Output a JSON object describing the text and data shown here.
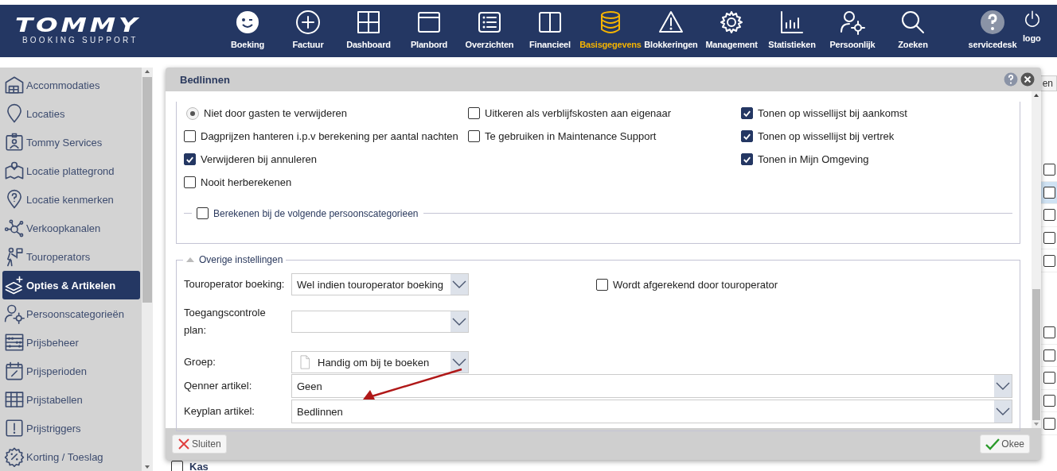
{
  "header": {
    "logo": {
      "title": "TOMMY",
      "subtitle": "BOOKING SUPPORT"
    },
    "nav": [
      {
        "label": "Boeking",
        "selected": false
      },
      {
        "label": "Factuur",
        "selected": false
      },
      {
        "label": "Dashboard",
        "selected": false
      },
      {
        "label": "Planbord",
        "selected": false
      },
      {
        "label": "Overzichten",
        "selected": false
      },
      {
        "label": "Financieel",
        "selected": false
      },
      {
        "label": "Basisgegevens",
        "selected": true
      },
      {
        "label": "Blokkeringen",
        "selected": false
      },
      {
        "label": "Management",
        "selected": false
      },
      {
        "label": "Statistieken",
        "selected": false
      },
      {
        "label": "Persoonlijk",
        "selected": false
      },
      {
        "label": "Zoeken",
        "selected": false
      }
    ],
    "right": [
      {
        "label": "servicedesk"
      },
      {
        "label": "logo"
      }
    ]
  },
  "sidebar": {
    "items": [
      {
        "label": "Accommodaties",
        "selected": false
      },
      {
        "label": "Locaties",
        "selected": false
      },
      {
        "label": "Tommy Services",
        "selected": false
      },
      {
        "label": "Locatie plattegrond",
        "selected": false
      },
      {
        "label": "Locatie kenmerken",
        "selected": false
      },
      {
        "label": "Verkoopkanalen",
        "selected": false
      },
      {
        "label": "Touroperators",
        "selected": false
      },
      {
        "label": "Opties & Artikelen",
        "selected": true
      },
      {
        "label": "Persoonscategorieën",
        "selected": false
      },
      {
        "label": "Prijsbeheer",
        "selected": false
      },
      {
        "label": "Prijsperioden",
        "selected": false
      },
      {
        "label": "Prijstabellen",
        "selected": false
      },
      {
        "label": "Prijstriggers",
        "selected": false
      },
      {
        "label": "Korting / Toeslag",
        "selected": false
      }
    ]
  },
  "background": {
    "button": "en",
    "rows": [
      {
        "checked": false,
        "selected": false
      },
      {
        "checked": false,
        "selected": true
      },
      {
        "checked": false,
        "selected": false
      },
      {
        "checked": false,
        "selected": false
      },
      {
        "checked": false,
        "selected": false
      },
      {
        "checked": false,
        "selected": false
      },
      {
        "checked": false,
        "selected": false
      },
      {
        "checked": false,
        "selected": false
      },
      {
        "checked": false,
        "selected": false
      },
      {
        "checked": false,
        "selected": false
      }
    ],
    "last_row": {
      "label": "Kas",
      "checked": false
    }
  },
  "dialog": {
    "title": "Bedlinnen",
    "options": [
      [
        {
          "kind": "radio",
          "label": "Niet door gasten te verwijderen",
          "selected": true
        },
        {
          "kind": "checkbox",
          "label": "Dagprijzen hanteren i.p.v berekening per aantal nachten",
          "checked": false
        },
        {
          "kind": "checkbox",
          "label": "Verwijderen bij annuleren",
          "checked": true
        },
        {
          "kind": "checkbox",
          "label": "Nooit herberekenen",
          "checked": false
        }
      ],
      [
        {
          "kind": "checkbox",
          "label": "Uitkeren als verblijfskosten aan eigenaar",
          "checked": false
        },
        {
          "kind": "checkbox",
          "label": "Te gebruiken in Maintenance Support",
          "checked": false
        }
      ],
      [
        {
          "kind": "checkbox",
          "label": "Tonen op wissellijst bij aankomst",
          "checked": true
        },
        {
          "kind": "checkbox",
          "label": "Tonen op wissellijst bij vertrek",
          "checked": true
        },
        {
          "kind": "checkbox",
          "label": "Tonen in Mijn Omgeving",
          "checked": true
        }
      ]
    ],
    "categories": {
      "label": "Berekenen bij de volgende persoonscategorieen",
      "checked": false
    },
    "other": {
      "legend": "Overige instellingen",
      "expanded": true,
      "fields": [
        {
          "kind": "select",
          "label": "Touroperator boeking:",
          "value": "Wel indien touroperator boeking",
          "wide": false
        },
        {
          "kind": "select",
          "label": "Toegangscontrole plan:",
          "wide": false
        },
        {
          "kind": "document-select",
          "label": "Groep:",
          "value": "Handig om bij te boeken",
          "wide": false
        },
        {
          "kind": "select",
          "label": "Qenner artikel:",
          "value": "Geen",
          "wide": true
        },
        {
          "kind": "select",
          "label": "Keyplan artikel:",
          "value": "Bedlinnen",
          "wide": true
        }
      ],
      "side_checkbox": {
        "label": "Wordt afgerekend door touroperator",
        "checked": false
      }
    },
    "buttons": [
      {
        "label": "Sluiten",
        "kind": "cancel"
      },
      {
        "label": "Okee",
        "kind": "ok"
      }
    ]
  }
}
